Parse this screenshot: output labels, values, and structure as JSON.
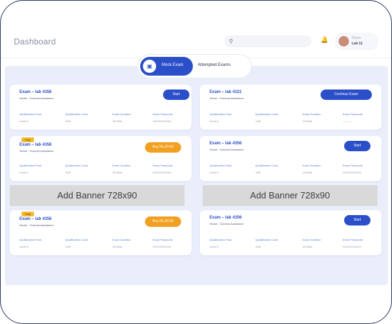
{
  "header": {
    "title": "Dashboard",
    "search_icon": "search-icon",
    "notification_icon": "bell-icon",
    "user": {
      "name": "Name",
      "role": "Lab 11"
    }
  },
  "tabs": {
    "active_label": "Mock Exam",
    "active_icon": "monitor-icon",
    "inactive_label": "Attempted Exams"
  },
  "meta_labels": [
    "Qualification Pack",
    "Qualification Code",
    "Exam Duration",
    "Exam Passcode"
  ],
  "cards": [
    {
      "name": "Exam – lab 4356",
      "sub": "Sector : Survival Assistance",
      "badge": "",
      "button": "Start",
      "button_color": "blue",
      "meta_values": [
        "Level 4",
        "1/45",
        "15 Mins",
        "XXXXXXXXXX"
      ]
    },
    {
      "name": "Exam – lab 4321",
      "sub": "Sector : Survival Assistance",
      "badge": "",
      "button": "Continue Exam",
      "button_color": "blue",
      "meta_values": [
        "Level 4",
        "1/45",
        "15 Mins",
        "———"
      ]
    },
    {
      "name": "Exam – lab 4356",
      "sub": "Sector : Survival Assistance",
      "badge": "Paid",
      "button": "Buy Rs.20.00",
      "button_color": "orange",
      "meta_values": [
        "Level 4",
        "1/45",
        "15 Mins",
        "XXXXXXXXXX"
      ]
    },
    {
      "name": "Exam – lab 4356",
      "sub": "Sector : Survival Assistance",
      "badge": "",
      "button": "Start",
      "button_color": "blue",
      "meta_values": [
        "Level 4",
        "1/45",
        "15 Mins",
        "XXXXXXXXXX"
      ]
    },
    {
      "name": "Exam – lab 4356",
      "sub": "Sector : Survival Assistance",
      "badge": "Paid",
      "button": "Buy Rs.20.00",
      "button_color": "orange",
      "meta_values": [
        "Level 4",
        "1/45",
        "15 Mins",
        "XXXXXXXXXX"
      ]
    },
    {
      "name": "Exam – lab 4356",
      "sub": "Sector : Survival Assistance",
      "badge": "",
      "button": "Start",
      "button_color": "blue",
      "meta_values": [
        "Level 4",
        "1/45",
        "15 Mins",
        "XXXXXXXXXX"
      ]
    }
  ],
  "banners": [
    "Add Banner 728x90",
    "Add Banner 728x90"
  ],
  "colors": {
    "accent": "#2a4fc9",
    "orange": "#f2a021",
    "panel": "#eaeefb",
    "badge": "#f4b92e"
  }
}
